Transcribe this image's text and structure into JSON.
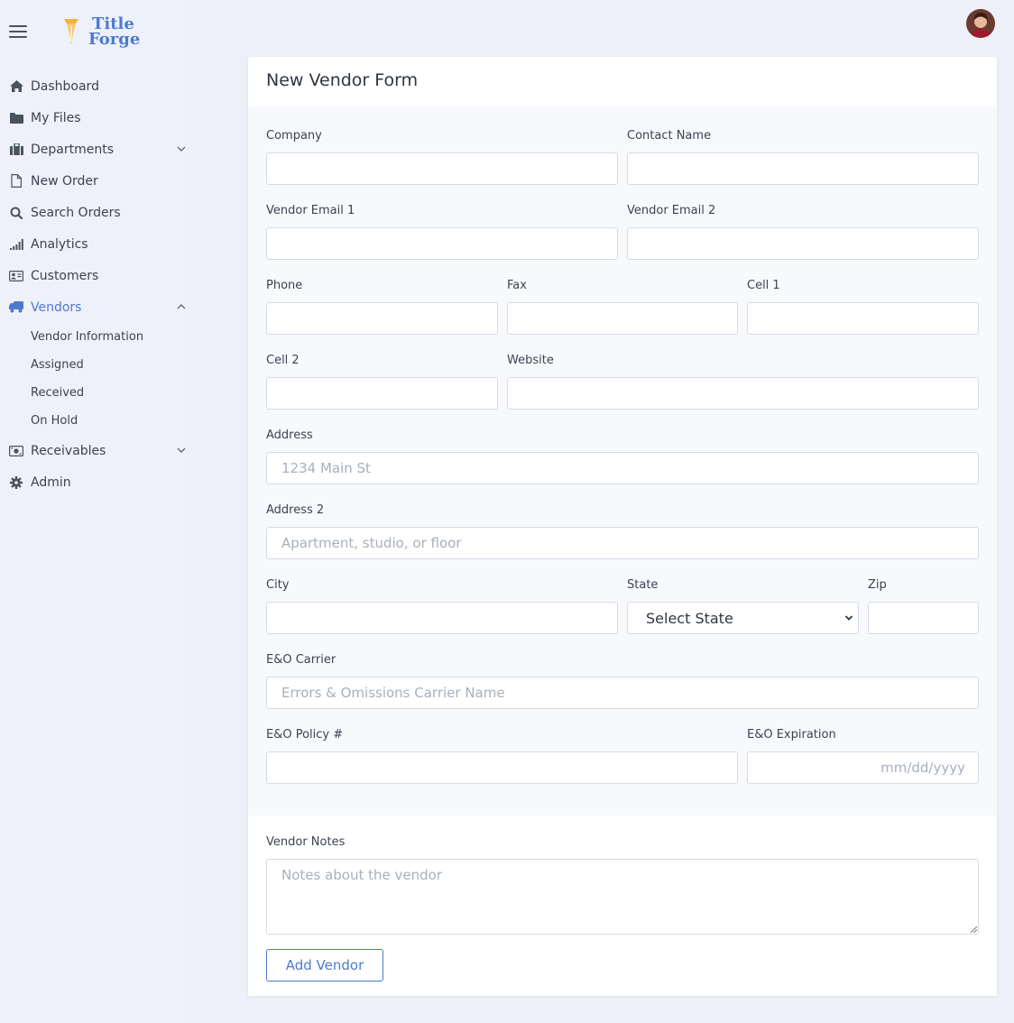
{
  "brand": {
    "line1": "Title",
    "line2": "Forge"
  },
  "sidebar": {
    "items": [
      {
        "label": "Dashboard",
        "icon": "home-icon"
      },
      {
        "label": "My Files",
        "icon": "folder-icon"
      },
      {
        "label": "Departments",
        "icon": "briefcase-icon"
      },
      {
        "label": "New Order",
        "icon": "file-icon"
      },
      {
        "label": "Search Orders",
        "icon": "search-icon"
      },
      {
        "label": "Analytics",
        "icon": "signal-icon"
      },
      {
        "label": "Customers",
        "icon": "id-card-icon"
      },
      {
        "label": "Vendors",
        "icon": "truck-icon"
      },
      {
        "label": "Receivables",
        "icon": "money-icon"
      },
      {
        "label": "Admin",
        "icon": "gear-icon"
      }
    ],
    "vendor_subitems": [
      "Vendor Information",
      "Assigned",
      "Received",
      "On Hold"
    ]
  },
  "form": {
    "title": "New Vendor Form",
    "company": {
      "label": "Company",
      "value": ""
    },
    "contact_name": {
      "label": "Contact Name",
      "value": ""
    },
    "vendor_email_1": {
      "label": "Vendor Email 1",
      "value": ""
    },
    "vendor_email_2": {
      "label": "Vendor Email 2",
      "value": ""
    },
    "phone": {
      "label": "Phone",
      "value": ""
    },
    "fax": {
      "label": "Fax",
      "value": ""
    },
    "cell_1": {
      "label": "Cell 1",
      "value": ""
    },
    "cell_2": {
      "label": "Cell 2",
      "value": ""
    },
    "website": {
      "label": "Website",
      "value": ""
    },
    "address": {
      "label": "Address",
      "placeholder": "1234 Main St"
    },
    "address_2": {
      "label": "Address 2",
      "placeholder": "Apartment, studio, or floor"
    },
    "city": {
      "label": "City",
      "value": ""
    },
    "state": {
      "label": "State",
      "selected": "Select State"
    },
    "zip": {
      "label": "Zip",
      "value": ""
    },
    "eo_carrier": {
      "label": "E&O Carrier",
      "placeholder": "Errors & Omissions Carrier Name"
    },
    "eo_policy": {
      "label": "E&O Policy #",
      "value": ""
    },
    "eo_expiration": {
      "label": "E&O Expiration",
      "placeholder": "mm/dd/yyyy"
    },
    "notes": {
      "label": "Vendor Notes",
      "placeholder": "Notes about the vendor"
    },
    "submit_label": "Add Vendor"
  },
  "colors": {
    "accent": "#4d7ad1",
    "background": "#edf0f9",
    "logo_gold": "#f0b43c"
  }
}
